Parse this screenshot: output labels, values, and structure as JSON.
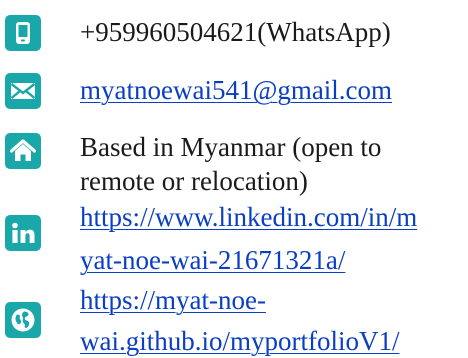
{
  "contacts": {
    "phone": {
      "icon": "smartphone-icon",
      "text": "+959960504621(WhatsApp)"
    },
    "email": {
      "icon": "envelope-icon",
      "text": "myatnoewai541@gmail.com"
    },
    "location": {
      "icon": "home-icon",
      "line1": "Based in Myanmar (open to",
      "line2": "remote or relocation)"
    },
    "linkedin": {
      "icon": "linkedin-icon",
      "line1": "https://www.linkedin.com/in/m",
      "line2": "yat-noe-wai-21671321a/"
    },
    "website": {
      "icon": "globe-icon",
      "line1": "https://myat-noe-",
      "line2": "wai.github.io/myportfolioV1/"
    }
  },
  "colors": {
    "icon_background": "#19a7a9",
    "link": "#0a3ec4",
    "text": "#1a1a1a"
  }
}
